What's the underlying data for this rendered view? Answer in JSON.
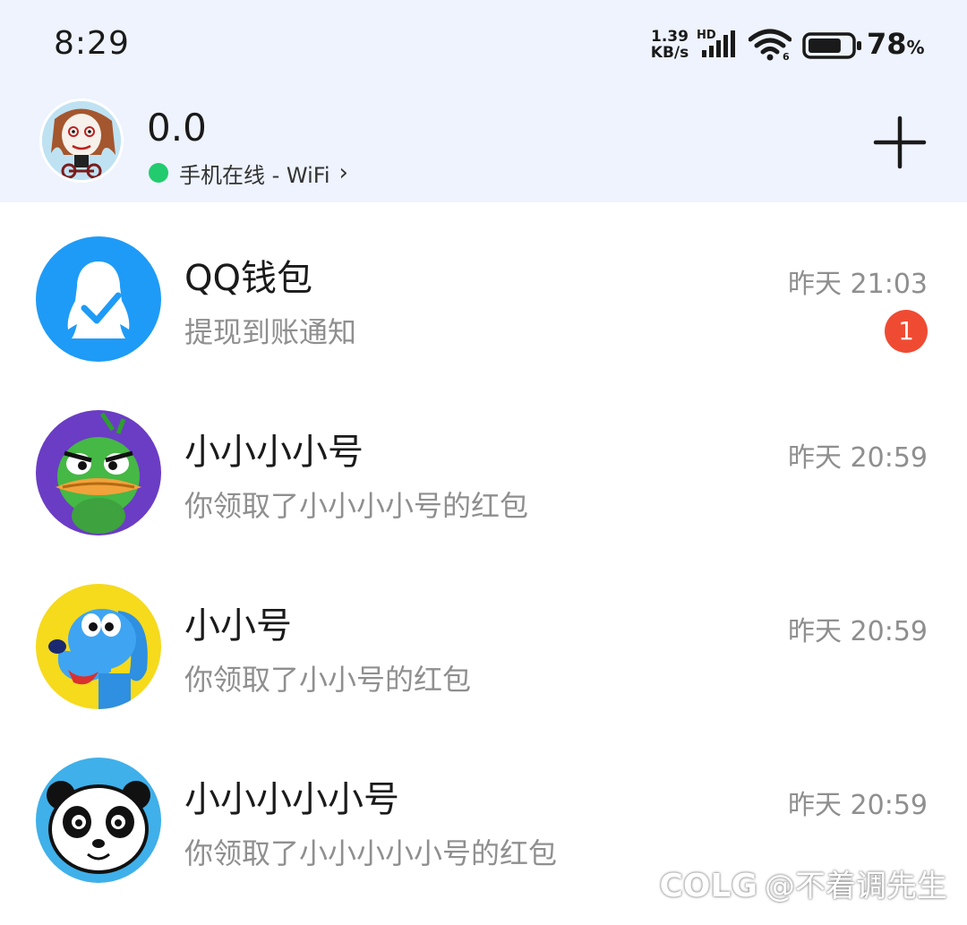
{
  "status_bar": {
    "time": "8:29",
    "net_speed_value": "1.39",
    "net_speed_unit": "KB/s",
    "network_label": "HD",
    "battery_percent": "78",
    "battery_percent_sign": "%",
    "battery_level": 0.78,
    "wifi_icon": "wifi-icon",
    "signal_icon": "cellular-signal-icon"
  },
  "header": {
    "nickname": "0.0",
    "online_status": "手机在线 - WiFi",
    "online_chevron": "›",
    "online_color": "#22cc6e",
    "add_icon": "plus-icon"
  },
  "chats": [
    {
      "name": "QQ钱包",
      "preview": "提现到账通知",
      "time": "昨天 21:03",
      "unread": "1",
      "avatar": "qq-wallet-logo"
    },
    {
      "name": "小小小小号",
      "preview": "你领取了小小小小号的红包",
      "time": "昨天 20:59",
      "unread": "",
      "avatar": "green-duck-avatar"
    },
    {
      "name": "小小号",
      "preview": "你领取了小小号的红包",
      "time": "昨天 20:59",
      "unread": "",
      "avatar": "blue-dog-avatar"
    },
    {
      "name": "小小小小小号",
      "preview": "你领取了小小小小小号的红包",
      "time": "昨天 20:59",
      "unread": "",
      "avatar": "panda-avatar"
    }
  ],
  "watermark": {
    "logo": "COLG",
    "text": "@不着调先生"
  },
  "colors": {
    "header_bg": "#eef3fd",
    "badge": "#ef4b33",
    "qq_blue": "#1e9bf7"
  }
}
